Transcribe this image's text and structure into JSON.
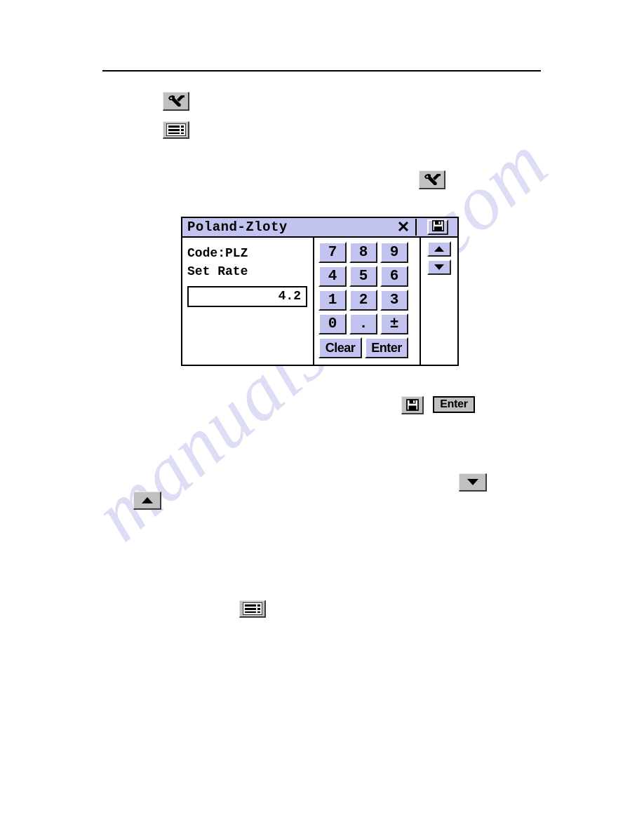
{
  "page": {
    "watermark": "manualshive.com"
  },
  "inline_icons": {
    "tools_top": "tools-icon",
    "list_top": "list-settings-icon",
    "tools_mid": "tools-icon",
    "save_mid": "save-floppy-icon",
    "enter_button_label": "Enter",
    "arrow_down": "arrow-down-icon",
    "arrow_up": "arrow-up-icon",
    "list_bottom": "list-settings-icon"
  },
  "dialog": {
    "title": "Poland-Zloty",
    "close_label": "✕",
    "save_icon": "save-floppy-icon",
    "code_line": "Code:PLZ",
    "rate_label": "Set Rate",
    "rate_value": "4.2",
    "keypad": {
      "rows": [
        [
          "7",
          "8",
          "9"
        ],
        [
          "4",
          "5",
          "6"
        ],
        [
          "1",
          "2",
          "3"
        ],
        [
          "0",
          ".",
          "±"
        ]
      ],
      "clear_label": "Clear",
      "enter_label": "Enter"
    },
    "scroll": {
      "up_icon": "arrow-up-icon",
      "down_icon": "arrow-down-icon"
    }
  },
  "colors": {
    "title_bar": "#c3c3f0",
    "key_face": "#c3c3f0",
    "button_face": "#c0c0c0",
    "watermark": "#c9cbef"
  }
}
